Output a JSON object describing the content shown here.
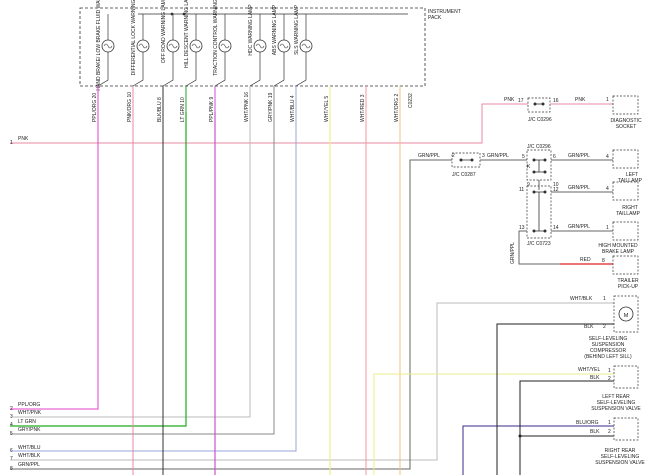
{
  "instrument_pack": {
    "title_line1": "INSTRUMENT",
    "title_line2": "PACK"
  },
  "lamps": [
    {
      "name": "HAND BRAKE/ LOW BRAKE FLUID WARNING LAMP",
      "wire": "PPL/ORG",
      "pin": "20",
      "color": "#e040c8"
    },
    {
      "name": "DIFFERENTIAL LOCK WARNING LAMP",
      "wire": "PNK/ORG",
      "pin": "10",
      "color": "#e88aa0"
    },
    {
      "name": "OFF ROAD WARNING LAMP",
      "wire": "BLK/BLU",
      "pin": "8",
      "color": "#333333"
    },
    {
      "name": "HILL DESCENT WARNING LAMP",
      "wire": "LT GRN",
      "pin": "10",
      "color": "#22aa22"
    },
    {
      "name": "TRACTION CONTROL WARNING LAMP",
      "wire": "PPL/PNK",
      "pin": "9",
      "color": "#d050d0"
    },
    {
      "name": "HDC WARNING LAMP",
      "wire": "WHT/PNK",
      "pin": "16",
      "color": "#bbbbbb"
    },
    {
      "name": "ABS WARNING LAMP",
      "wire": "GRY/PNK",
      "pin": "19",
      "color": "#888888"
    },
    {
      "name": "SLS WARNING LAMP",
      "wire": "WHT/BLU",
      "pin": "4",
      "color": "#9aa6d8"
    },
    {
      "wire": "WHT/YEL",
      "pin": "5",
      "color": "#eeee88"
    },
    {
      "wire": "WHT/RED",
      "pin": "3",
      "color": "#ee9999"
    },
    {
      "wire": "WHT/ORG",
      "pin": "2",
      "color": "#f0c080"
    }
  ],
  "connector_id": "C0232",
  "left_wires": [
    {
      "num": "1",
      "label": "PNK"
    },
    {
      "num": "2",
      "label": "PPL/ORG"
    },
    {
      "num": "3",
      "label": "WHT/PNK"
    },
    {
      "num": "4",
      "label": "LT GRN"
    },
    {
      "num": "5",
      "label": "GRY/PNK"
    },
    {
      "num": "6",
      "label": "WHT/BLU"
    },
    {
      "num": "7",
      "label": "WHT/BLK"
    },
    {
      "num": "8",
      "label": "GRN/PPL"
    }
  ],
  "junctions": {
    "c0296": "J/C C0296",
    "c0296b": "J/C C0296",
    "c0287": "J/C C0287",
    "c0723": "J/C C0723"
  },
  "right_wires": {
    "pnk_a": "PNK",
    "pnk_b": "PNK",
    "pin17": "17",
    "pin16": "16",
    "grnppl_1": "GRN/PPL",
    "grnppl_2": "GRN/PPL",
    "grnppl_3": "GRN/PPL",
    "grnppl_4": "GRN/PPL",
    "grnppl_5": "GRN/PPL",
    "grnppl_6": "GRN/PPL",
    "red": "RED",
    "wht_blk": "WHT/BLK",
    "blk1": "BLK",
    "wht_yel": "WHT/YEL",
    "blk2": "BLK",
    "blu_org": "BLU/ORG",
    "blk3": "BLK"
  },
  "pins": {
    "p2": "2",
    "p3": "3",
    "p5": "5",
    "p6": "6",
    "p4": "4",
    "p9": "9",
    "p10": "10",
    "p11": "11",
    "p12": "12",
    "p13": "13",
    "p14": "14",
    "k": "K",
    "one": "1",
    "four": "4",
    "eight": "8",
    "one_b": "1",
    "two_b": "2",
    "one_c": "1",
    "two_c": "2",
    "one_d": "1",
    "two_d": "2",
    "one_e": "1",
    "one_f": "1",
    "one_g": "1"
  },
  "components": {
    "diag_socket": [
      "DIAGNOSTIC",
      "SOCKET"
    ],
    "left_taillamp": [
      "LEFT",
      "TAILLAMP"
    ],
    "right_taillamp": [
      "RIGHT",
      "TAILLAMP"
    ],
    "brake_lamp": [
      "HIGH MOUNTED",
      "BRAKE LAMP"
    ],
    "trailer": [
      "TRAILER",
      "PICK-UP"
    ],
    "compressor": [
      "SELF-LEVELING",
      "SUSPENSION",
      "COMPRESSOR",
      "(BEHIND LEFT SILL)"
    ],
    "left_valve": [
      "LEFT REAR",
      "SELF-LEVELING",
      "SUSPENSION VALVE"
    ],
    "right_valve": [
      "RIGHT REAR",
      "SELF-LEVELING",
      "SUSPENSION VALVE"
    ],
    "motor_symbol": "M"
  }
}
